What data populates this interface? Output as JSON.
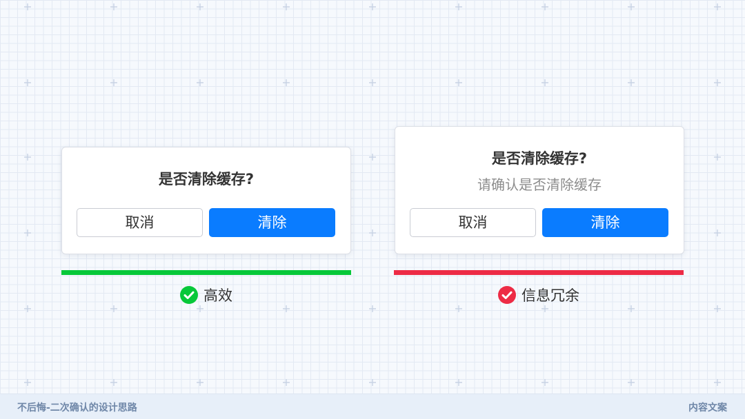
{
  "examples": [
    {
      "dialog": {
        "title": "是否清除缓存?",
        "subtitle": "",
        "cancel_label": "取消",
        "confirm_label": "清除"
      },
      "verdict": {
        "label": "高效",
        "bar_color": "#07c839",
        "icon": "check-icon",
        "icon_color": "#07c839"
      }
    },
    {
      "dialog": {
        "title": "是否清除缓存?",
        "subtitle": "请确认是否清除缓存",
        "cancel_label": "取消",
        "confirm_label": "清除"
      },
      "verdict": {
        "label": "信息冗余",
        "bar_color": "#ed2b45",
        "icon": "check-icon",
        "icon_color": "#ed2b45"
      }
    }
  ],
  "footer": {
    "left_text": "不后悔-二次确认的设计思路",
    "right_text": "内容文案"
  },
  "colors": {
    "primary_button": "#0a7cff",
    "background": "#f6f9fd"
  }
}
